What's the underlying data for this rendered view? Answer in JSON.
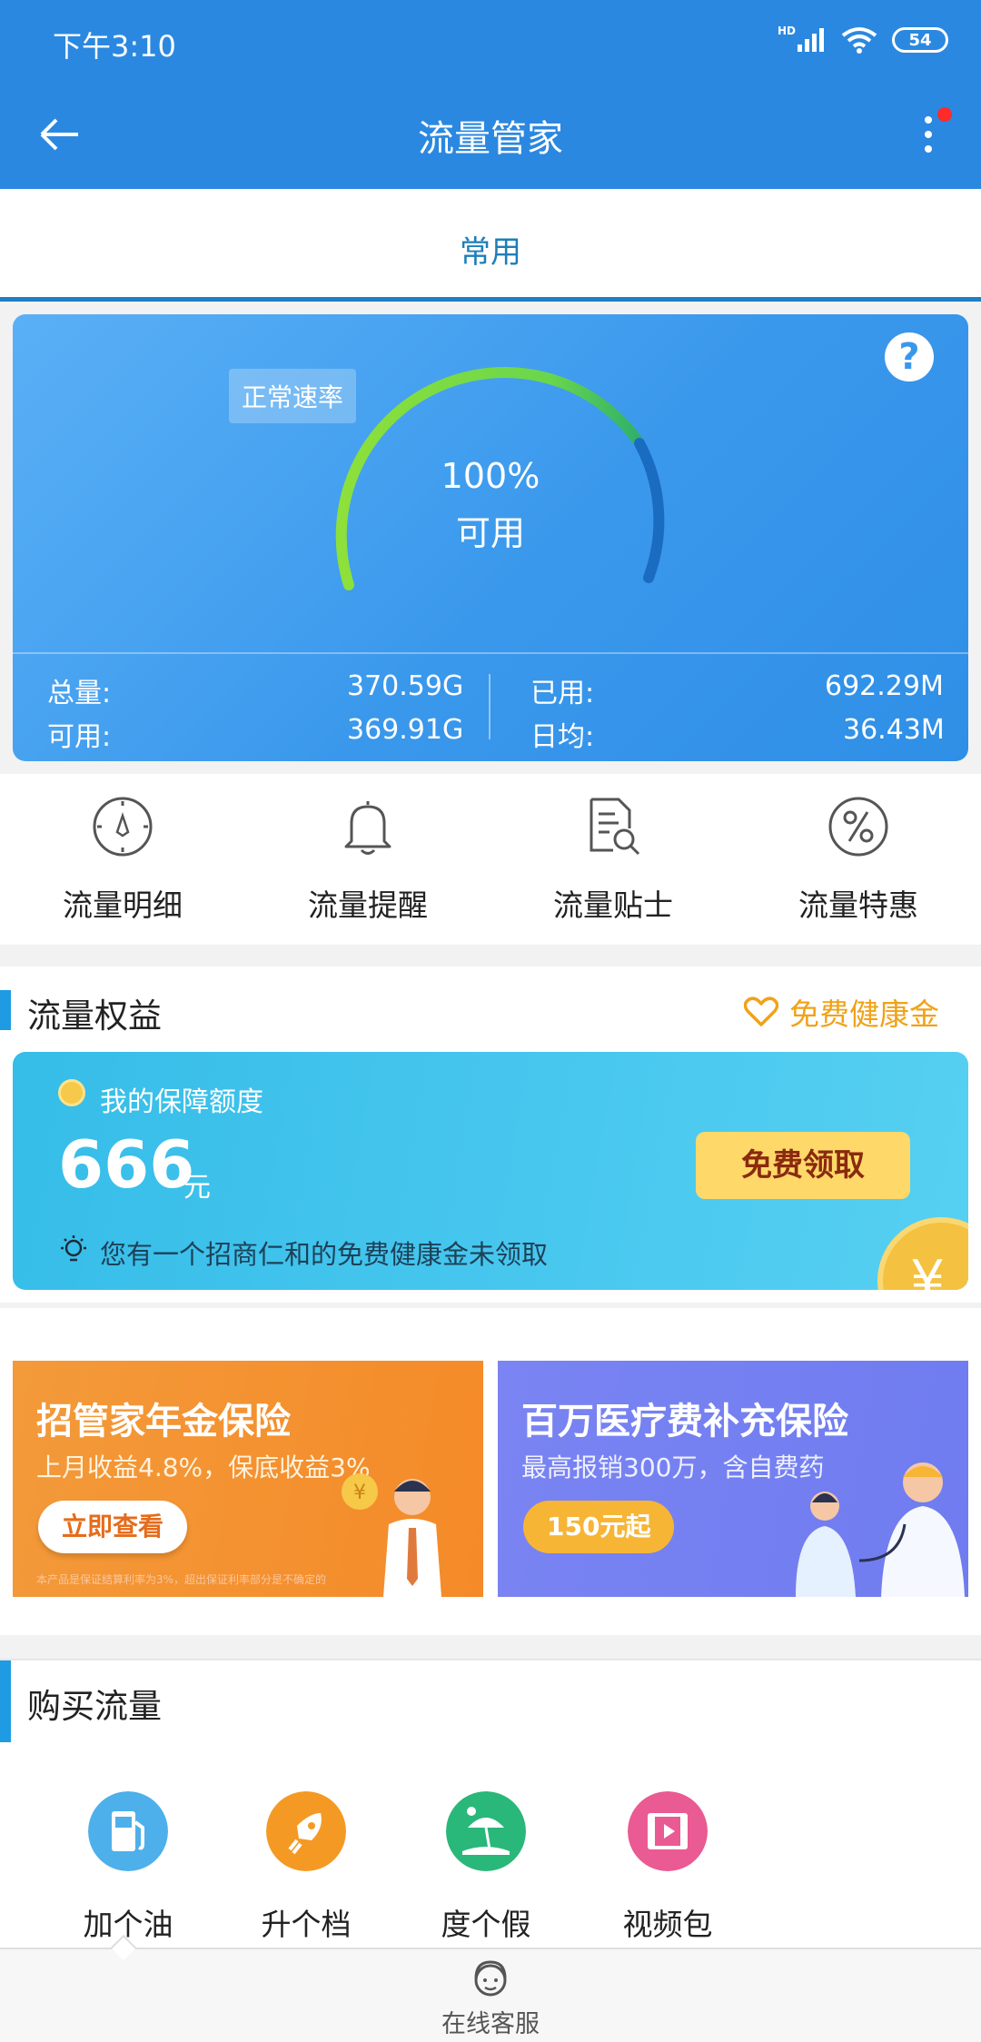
{
  "status_bar": {
    "time": "下午3:10",
    "network": "HD",
    "battery": "54"
  },
  "app_bar": {
    "title": "流量管家"
  },
  "tabs": [
    {
      "label": "常用",
      "selected": true
    }
  ],
  "gauge": {
    "badge": "正常速率",
    "percent": "100%",
    "status": "可用",
    "help": "?",
    "ratio": 1.0
  },
  "stats": {
    "total_label": "总量:",
    "total_value": "370.59G",
    "available_label": "可用:",
    "available_value": "369.91G",
    "used_label": "已用:",
    "used_value": "692.29M",
    "daily_label": "日均:",
    "daily_value": "36.43M"
  },
  "tools": [
    {
      "label": "流量明细",
      "icon": "compass-icon"
    },
    {
      "label": "流量提醒",
      "icon": "bell-icon"
    },
    {
      "label": "流量贴士",
      "icon": "document-search-icon"
    },
    {
      "label": "流量特惠",
      "icon": "percent-icon"
    }
  ],
  "benefits": {
    "title": "流量权益",
    "link": "免费健康金",
    "card": {
      "title": "我的保障额度",
      "amount": "666",
      "unit": "元",
      "button": "免费领取",
      "notice": "您有一个招商仁和的免费健康金未领取"
    }
  },
  "promos": [
    {
      "title": "招管家年金保险",
      "subtitle": "上月收益4.8%，保底收益3%",
      "button": "立即查看",
      "fine_print": "本产品是保证结算利率为3%，超出保证利率部分是不确定的"
    },
    {
      "title": "百万医疗费补充保险",
      "subtitle": "最高报销300万，含自费药",
      "button": "150元起"
    }
  ],
  "buy": {
    "title": "购买流量",
    "items": [
      {
        "label": "加个油",
        "icon": "fuel-icon",
        "color": "#4db0ea"
      },
      {
        "label": "升个档",
        "icon": "rocket-icon",
        "color": "#f49a24"
      },
      {
        "label": "度个假",
        "icon": "beach-icon",
        "color": "#2ab77a"
      },
      {
        "label": "视频包",
        "icon": "film-icon",
        "color": "#ea5a93"
      }
    ]
  },
  "bottom_bar": {
    "label": "在线客服"
  },
  "colors": {
    "primary": "#2b88e0",
    "accent": "#1e9be3",
    "gold": "#f0a218"
  }
}
